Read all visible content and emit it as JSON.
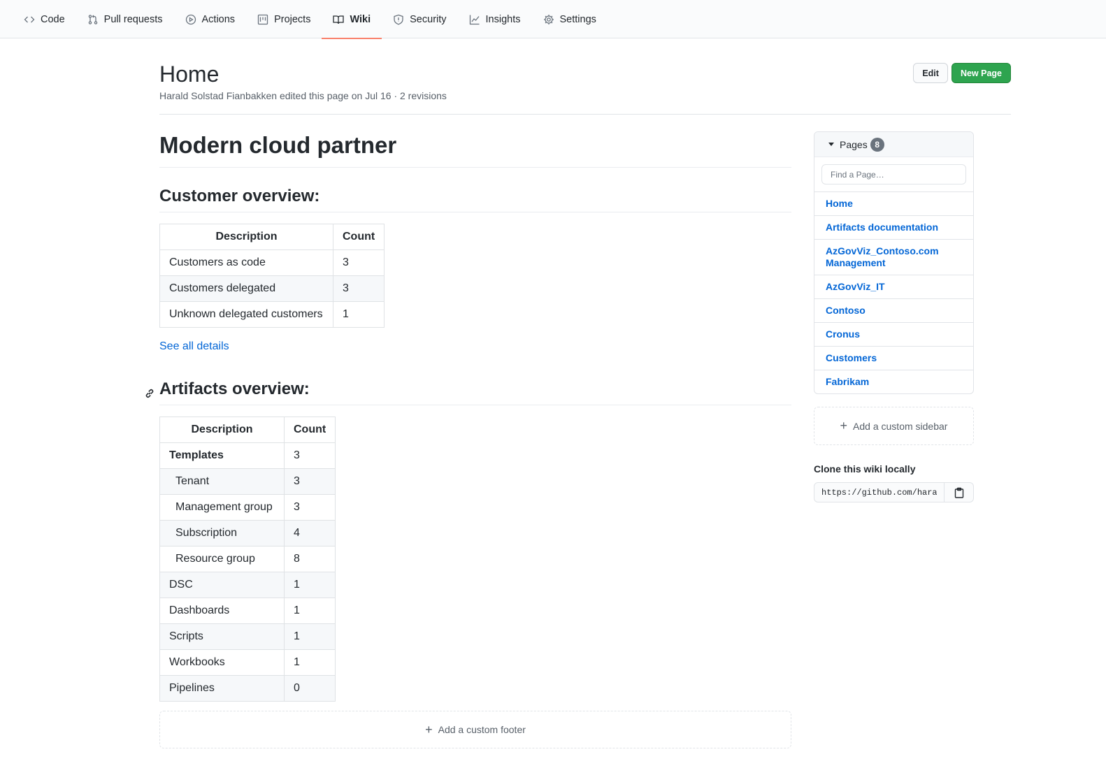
{
  "nav": {
    "tabs": [
      {
        "label": "Code",
        "icon": "code-icon"
      },
      {
        "label": "Pull requests",
        "icon": "git-pull-request-icon"
      },
      {
        "label": "Actions",
        "icon": "play-icon"
      },
      {
        "label": "Projects",
        "icon": "project-icon"
      },
      {
        "label": "Wiki",
        "icon": "book-icon",
        "selected": true
      },
      {
        "label": "Security",
        "icon": "shield-icon"
      },
      {
        "label": "Insights",
        "icon": "graph-icon"
      },
      {
        "label": "Settings",
        "icon": "gear-icon"
      }
    ],
    "selected_underline_color": "#f9826c"
  },
  "header": {
    "title": "Home",
    "meta": "Harald Solstad Fianbakken edited this page on Jul 16 · 2 revisions",
    "edit_label": "Edit",
    "new_page_label": "New Page",
    "primary_color": "#2ea44f"
  },
  "content": {
    "h1": "Modern cloud partner",
    "customer_heading": "Customer overview:",
    "customer_table": {
      "headers": [
        "Description",
        "Count"
      ],
      "rows": [
        [
          "Customers as code",
          "3"
        ],
        [
          "Customers delegated",
          "3"
        ],
        [
          "Unknown delegated customers",
          "1"
        ]
      ]
    },
    "see_all_link": "See all details",
    "artifacts_heading": "Artifacts overview:",
    "artifacts_table": {
      "headers": [
        "Description",
        "Count"
      ],
      "rows": [
        [
          "Templates",
          "3"
        ],
        [
          "Tenant",
          "3"
        ],
        [
          "Management group",
          "3"
        ],
        [
          "Subscription",
          "4"
        ],
        [
          "Resource group",
          "8"
        ],
        [
          "DSC",
          "1"
        ],
        [
          "Dashboards",
          "1"
        ],
        [
          "Scripts",
          "1"
        ],
        [
          "Workbooks",
          "1"
        ],
        [
          "Pipelines",
          "0"
        ]
      ]
    },
    "footer_label": "Add a custom footer"
  },
  "sidebar": {
    "pages_label": "Pages",
    "pages_count": "8",
    "filter_placeholder": "Find a Page…",
    "pages": [
      "Home",
      "Artifacts documentation",
      "AzGovViz_Contoso.com Management",
      "AzGovViz_IT",
      "Contoso",
      "Cronus",
      "Customers",
      "Fabrikam"
    ],
    "custom_sidebar_label": "Add a custom sidebar",
    "clone_title": "Clone this wiki locally",
    "clone_url": "https://github.com/haraldfianbakken/"
  }
}
